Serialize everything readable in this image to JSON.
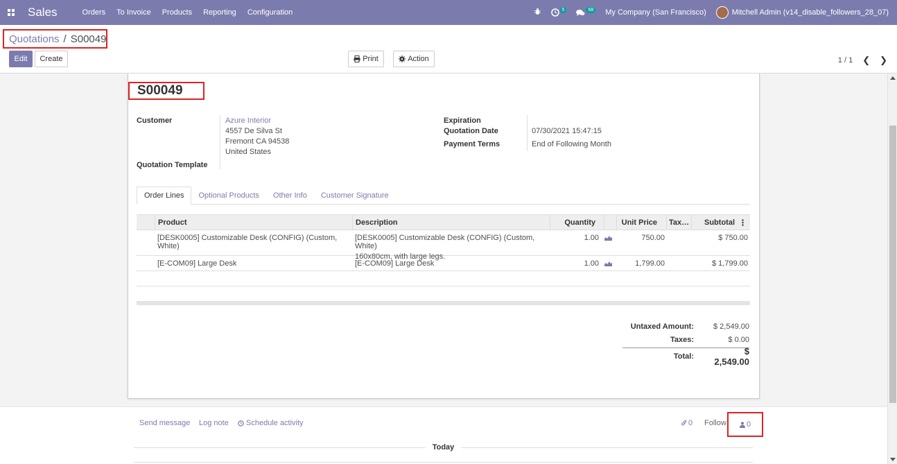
{
  "navbar": {
    "app_name": "Sales",
    "menu": [
      "Orders",
      "To Invoice",
      "Products",
      "Reporting",
      "Configuration"
    ],
    "activity_count": "5",
    "message_count": "68",
    "company": "My Company (San Francisco)",
    "user": "Mitchell Admin (v14_disable_followers_28_07)"
  },
  "breadcrumb": {
    "parent": "Quotations",
    "separator": "/",
    "current": "S00049"
  },
  "toolbar": {
    "edit": "Edit",
    "create": "Create",
    "print": "Print",
    "action": "Action",
    "pager": "1 / 1"
  },
  "record": {
    "name": "S00049",
    "customer_label": "Customer",
    "customer_name": "Azure Interior",
    "customer_addr1": "4557 De Silva St",
    "customer_addr2": "Fremont CA 94538",
    "customer_addr3": "United States",
    "template_label": "Quotation Template",
    "expiration_label": "Expiration",
    "quotation_date_label": "Quotation Date",
    "quotation_date": "07/30/2021 15:47:15",
    "payment_terms_label": "Payment Terms",
    "payment_terms": "End of Following Month"
  },
  "tabs": [
    "Order Lines",
    "Optional Products",
    "Other Info",
    "Customer Signature"
  ],
  "lines": {
    "headers": {
      "product": "Product",
      "description": "Description",
      "quantity": "Quantity",
      "unit_price": "Unit Price",
      "tax": "Tax…",
      "subtotal": "Subtotal"
    },
    "rows": [
      {
        "product": "[DESK0005] Customizable Desk (CONFIG) (Custom, White)",
        "desc1": "[DESK0005] Customizable Desk (CONFIG) (Custom, White)",
        "desc2": "160x80cm, with large legs.",
        "qty": "1.00",
        "price": "750.00",
        "subtotal": "$ 750.00"
      },
      {
        "product": "[E-COM09] Large Desk",
        "desc1": "[E-COM09] Large Desk",
        "desc2": "",
        "qty": "1.00",
        "price": "1,799.00",
        "subtotal": "$ 1,799.00"
      }
    ]
  },
  "totals": {
    "untaxed_label": "Untaxed Amount:",
    "untaxed": "$ 2,549.00",
    "taxes_label": "Taxes:",
    "taxes": "$ 0.00",
    "total_label": "Total:",
    "total": "$ 2,549.00"
  },
  "chatter": {
    "send_message": "Send message",
    "log_note": "Log note",
    "schedule_activity": "Schedule activity",
    "attachments": "0",
    "follow": "Follow",
    "followers": "0",
    "today": "Today"
  },
  "colors": {
    "brand": "#7c7bad",
    "highlight": "#dd2222"
  }
}
